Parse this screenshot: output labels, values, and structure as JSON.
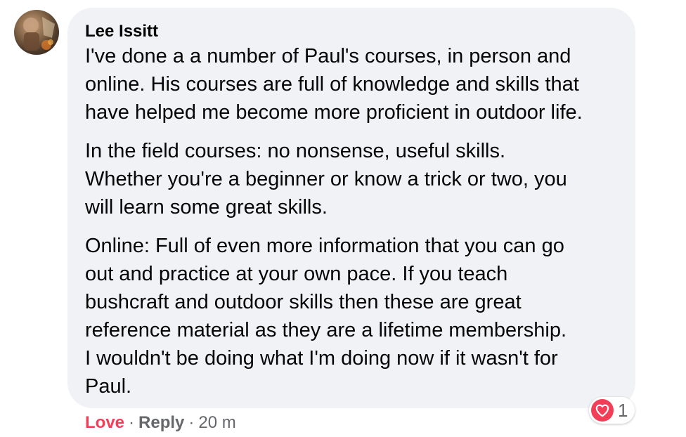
{
  "comment": {
    "author": "Lee Issitt",
    "paragraphs": [
      "I've done a a number of Paul's courses, in person and\nonline. His courses are full of knowledge and skills that\nhave helped me become more proficient in outdoor life.",
      "In the field courses: no nonsense, useful skills.\nWhether you're a beginner or know a trick or two, you\nwill learn some great skills.",
      "Online: Full of even more information that you can go\nout and practice at your own pace. If you teach\nbushcraft and outdoor skills then these are great\nreference material as they are a lifetime membership.\nI wouldn't be doing what I'm doing now if it wasn't for\nPaul."
    ]
  },
  "reactions": {
    "icon": "heart-icon",
    "count": "1",
    "color": "#f33e58"
  },
  "actions": {
    "love_label": "Love",
    "separator": "·",
    "reply_label": "Reply",
    "timestamp": "20 m"
  },
  "colors": {
    "bubble_bg": "#f0f2f5",
    "text": "#050505",
    "secondary_text": "#65676b",
    "love": "#f33e58"
  }
}
